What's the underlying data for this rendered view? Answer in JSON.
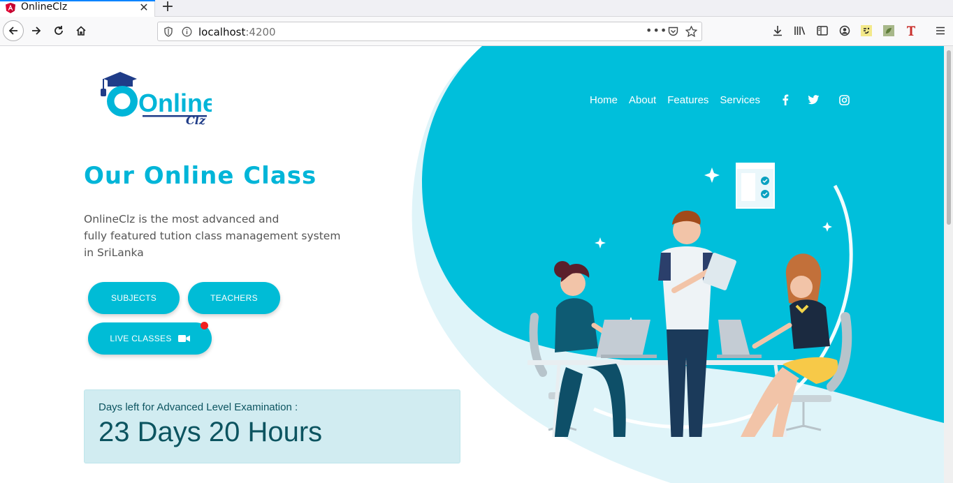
{
  "browser": {
    "tab_title": "OnlineClz",
    "url_host": "localhost",
    "url_port": ":4200"
  },
  "nav": {
    "links": [
      "Home",
      "About",
      "Features",
      "Services"
    ],
    "social": [
      "facebook-icon",
      "twitter-icon",
      "instagram-icon"
    ]
  },
  "logo": {
    "text": "Online",
    "sub": "Clz"
  },
  "hero": {
    "title": "Our Online Class",
    "description_lines": [
      "OnlineClz is the most advanced and",
      "fully featured tution class management system",
      "in SriLanka"
    ]
  },
  "buttons": {
    "subjects": "SUBJECTS",
    "teachers": "TEACHERS",
    "live_classes": "LIVE CLASSES"
  },
  "countdown": {
    "label": "Days left for Advanced Level Examination :",
    "value": "23 Days 20 Hours"
  },
  "colors": {
    "accent": "#00bcd6",
    "accent_light": "#dff4f9",
    "alert_bg": "#d1ecf1",
    "alert_text": "#0c5460",
    "notify_dot": "#f21f1f"
  }
}
